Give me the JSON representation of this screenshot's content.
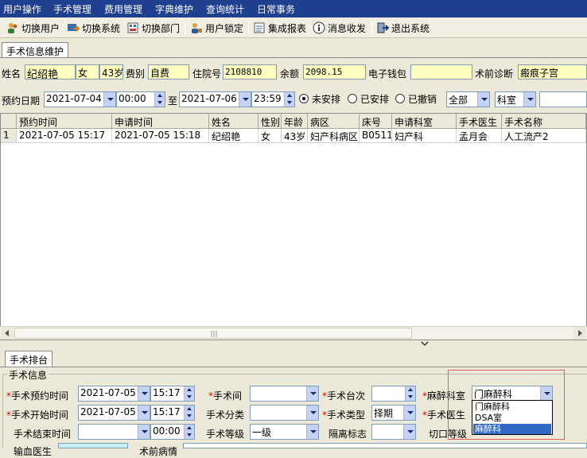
{
  "menu": [
    "用户操作",
    "手术管理",
    "费用管理",
    "字典维护",
    "查询统计",
    "日常事务"
  ],
  "toolbar": {
    "switch_user": "切换用户",
    "switch_system": "切换系统",
    "switch_dept": "切换部门",
    "user_lock": "用户锁定",
    "integrated_report": "集成报表",
    "messages": "消息收发",
    "exit": "退出系统"
  },
  "top_tab": "手术信息维护",
  "patient": {
    "name_label": "姓名",
    "name": "纪绍艳",
    "sex": "女",
    "age": "43岁",
    "fee_label": "费别",
    "fee": "自费",
    "inpatient_no_label": "住院号",
    "inpatient_no": "2108810",
    "balance_label": "余额",
    "balance": "2098.15",
    "wallet_label": "电子钱包",
    "wallet": "",
    "diagnosis_label": "术前诊断",
    "diagnosis": "瘢痕子宫"
  },
  "filter": {
    "date_label": "预约日期",
    "from_date": "2021-07-04",
    "from_time": "00:00",
    "to_label": "至",
    "to_date": "2021-07-06",
    "to_time": "23:59",
    "radio_unscheduled": "未安排",
    "radio_scheduled": "已安排",
    "radio_cancelled": "已撤销",
    "scope": "全部",
    "dept": "科室",
    "search_value": ""
  },
  "grid": {
    "headers": [
      "预约时间",
      "申请时间",
      "姓名",
      "性别",
      "年龄",
      "病区",
      "床号",
      "申请科室",
      "手术医生",
      "手术名称"
    ],
    "rows": [
      [
        "1",
        "2021-07-05 15:17",
        "2021-07-05 15:18",
        "纪绍艳",
        "女",
        "43岁",
        "妇产科病区",
        "B0511",
        "妇产科",
        "孟月会",
        "人工流产2"
      ]
    ]
  },
  "bottom_tab": "手术排台",
  "group_title": "手术信息",
  "form": {
    "appt_time_label": "手术预约时间",
    "appt_date": "2021-07-05",
    "appt_time": "15:17",
    "start_time_label": "手术开始时间",
    "start_date": "2021-07-05",
    "start_time": "15:17",
    "end_time_label": "手术结束时间",
    "end_date": "",
    "end_time": "00:00",
    "room_label": "手术间",
    "room": "",
    "category_label": "手术分类",
    "category": "",
    "level_label": "手术等级",
    "level": "一级",
    "sequence_label": "手术台次",
    "sequence": "",
    "type_label": "手术类型",
    "type": "择期",
    "isolation_label": "隔离标志",
    "isolation": "",
    "anesth_dept_label": "麻醉科室",
    "anesth_dept": "门麻醉科",
    "surgeon_label": "手术医生",
    "incision_label": "切口等级",
    "transfusion_label": "输血医生",
    "postop_label": "术前病情"
  },
  "dropdown": {
    "options": [
      "门麻醉科",
      "DSA室",
      "麻醉科"
    ],
    "selected": "麻醉科"
  }
}
